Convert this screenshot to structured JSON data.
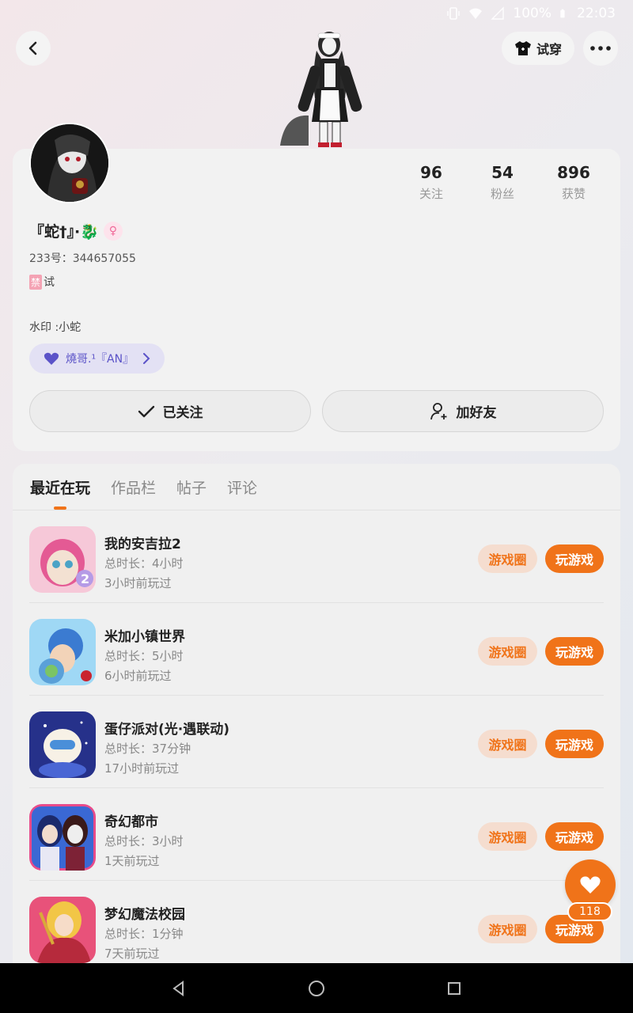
{
  "status_bar": {
    "battery": "100%",
    "time": "22:03"
  },
  "header": {
    "try_on_label": "试穿"
  },
  "profile": {
    "nickname": "『蛇†』·🐉",
    "gender_symbol": "♀",
    "uid": "233号：344657055",
    "ban_tag": "禁",
    "bio_suffix": "试",
    "watermark": "水印 :小蛇",
    "relation_chip": "燒哥.¹『AN』",
    "stats": [
      {
        "num": "96",
        "label": "关注"
      },
      {
        "num": "54",
        "label": "粉丝"
      },
      {
        "num": "896",
        "label": "获赞"
      }
    ],
    "follow_label": "已关注",
    "add_friend_label": "加好友"
  },
  "tabs": [
    {
      "label": "最近在玩",
      "active": true
    },
    {
      "label": "作品栏",
      "active": false
    },
    {
      "label": "帖子",
      "active": false
    },
    {
      "label": "评论",
      "active": false
    }
  ],
  "games": [
    {
      "name": "我的安吉拉2",
      "duration": "总时长：4小时",
      "last_played": "3小时前玩过",
      "circle_label": "游戏圈",
      "play_label": "玩游戏"
    },
    {
      "name": "米加小镇世界",
      "duration": "总时长：5小时",
      "last_played": "6小时前玩过",
      "circle_label": "游戏圈",
      "play_label": "玩游戏"
    },
    {
      "name": "蛋仔派对(光·遇联动)",
      "duration": "总时长：37分钟",
      "last_played": "17小时前玩过",
      "circle_label": "游戏圈",
      "play_label": "玩游戏"
    },
    {
      "name": "奇幻都市",
      "duration": "总时长：3小时",
      "last_played": "1天前玩过",
      "circle_label": "游戏圈",
      "play_label": "玩游戏"
    },
    {
      "name": "梦幻魔法校园",
      "duration": "总时长：1分钟",
      "last_played": "7天前玩过",
      "circle_label": "游戏圈",
      "play_label": "玩游戏"
    }
  ],
  "float_like": {
    "count": "118"
  },
  "colors": {
    "accent": "#f07319",
    "accent_light": "#f5ddcf",
    "chip_text": "#5b53c8"
  }
}
